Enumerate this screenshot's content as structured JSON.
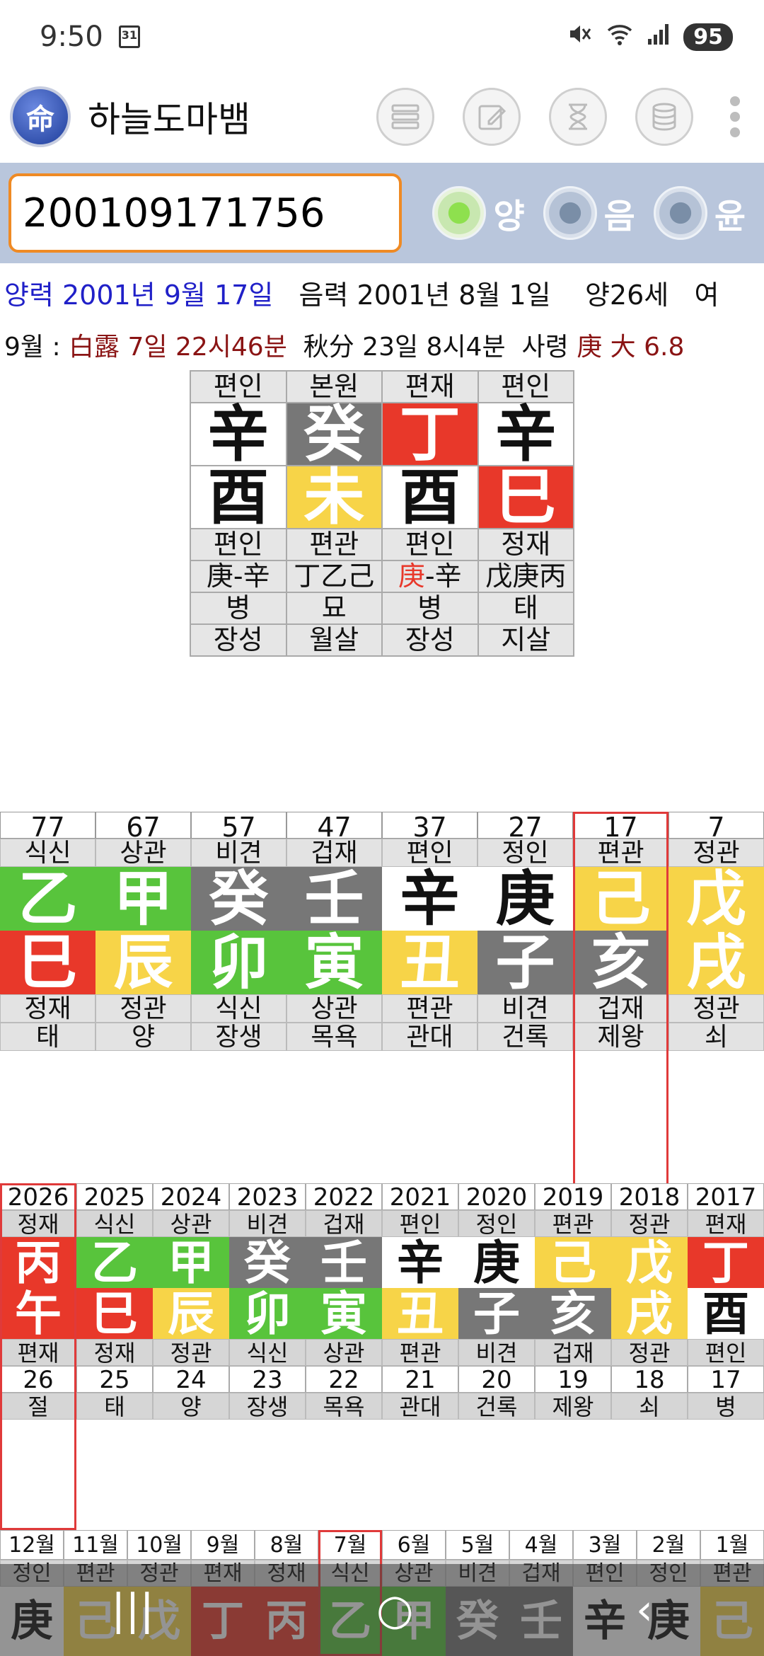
{
  "status": {
    "time": "9:50",
    "calendar_day": "31",
    "battery": "95"
  },
  "app": {
    "title": "하늘도마뱀",
    "logo_char": "命"
  },
  "input": {
    "value": "200109171756"
  },
  "radios": [
    {
      "label": "양",
      "selected": true
    },
    {
      "label": "음",
      "selected": false
    },
    {
      "label": "윤",
      "selected": false
    }
  ],
  "info": {
    "solar": "양력 2001년 9월 17일",
    "lunar": "음력 2001년 8월 1일",
    "age": "양26세",
    "gender": "여",
    "month_prefix": "9월 : ",
    "term1": "白露 7일 22시46분",
    "term2": "秋分 23일 8시4분",
    "saryeong_label": "사령",
    "saryeong_char": "庚",
    "saryeong_rest": "大 6.8"
  },
  "pillars": {
    "top_labels": [
      "편인",
      "본원",
      "편재",
      "편인"
    ],
    "stems": [
      {
        "char": "辛",
        "color": "white"
      },
      {
        "char": "癸",
        "color": "gray"
      },
      {
        "char": "丁",
        "color": "red"
      },
      {
        "char": "辛",
        "color": "white"
      }
    ],
    "branches": [
      {
        "char": "酉",
        "color": "white"
      },
      {
        "char": "未",
        "color": "yellow"
      },
      {
        "char": "酉",
        "color": "white"
      },
      {
        "char": "巳",
        "color": "red"
      }
    ],
    "bottom_labels": [
      "편인",
      "편관",
      "편인",
      "정재"
    ],
    "hidden": [
      {
        "a": "庚",
        "b": "-",
        "c": "辛",
        "hl": false
      },
      {
        "a": "丁",
        "b": "乙",
        "c": "己",
        "hl": false
      },
      {
        "a": "庚",
        "b": "-",
        "c": "辛",
        "hl": true
      },
      {
        "a": "戊",
        "b": "庚",
        "c": "丙",
        "hl": false
      }
    ],
    "stage": [
      "병",
      "묘",
      "병",
      "태"
    ],
    "sal": [
      "장성",
      "월살",
      "장성",
      "지살"
    ]
  },
  "daeun": {
    "ages": [
      "77",
      "67",
      "57",
      "47",
      "37",
      "27",
      "17",
      "7"
    ],
    "top_labels": [
      "식신",
      "상관",
      "비견",
      "겁재",
      "편인",
      "정인",
      "편관",
      "정관"
    ],
    "stems": [
      {
        "char": "乙",
        "color": "green"
      },
      {
        "char": "甲",
        "color": "green"
      },
      {
        "char": "癸",
        "color": "gray"
      },
      {
        "char": "壬",
        "color": "gray"
      },
      {
        "char": "辛",
        "color": "white"
      },
      {
        "char": "庚",
        "color": "white"
      },
      {
        "char": "己",
        "color": "yellow"
      },
      {
        "char": "戊",
        "color": "yellow"
      }
    ],
    "branches": [
      {
        "char": "巳",
        "color": "red"
      },
      {
        "char": "辰",
        "color": "yellow"
      },
      {
        "char": "卯",
        "color": "green"
      },
      {
        "char": "寅",
        "color": "green"
      },
      {
        "char": "丑",
        "color": "yellow"
      },
      {
        "char": "子",
        "color": "gray"
      },
      {
        "char": "亥",
        "color": "gray"
      },
      {
        "char": "戌",
        "color": "yellow"
      }
    ],
    "bottom_labels": [
      "정재",
      "정관",
      "식신",
      "상관",
      "편관",
      "비견",
      "겁재",
      "정관"
    ],
    "stage": [
      "태",
      "양",
      "장생",
      "목욕",
      "관대",
      "건록",
      "제왕",
      "쇠"
    ],
    "selected_index": 6
  },
  "yearly": {
    "years": [
      "2026",
      "2025",
      "2024",
      "2023",
      "2022",
      "2021",
      "2020",
      "2019",
      "2018",
      "2017"
    ],
    "top_labels": [
      "정재",
      "식신",
      "상관",
      "비견",
      "겁재",
      "편인",
      "정인",
      "편관",
      "정관",
      "편재"
    ],
    "stems": [
      {
        "char": "丙",
        "color": "red"
      },
      {
        "char": "乙",
        "color": "green"
      },
      {
        "char": "甲",
        "color": "green"
      },
      {
        "char": "癸",
        "color": "gray"
      },
      {
        "char": "壬",
        "color": "gray"
      },
      {
        "char": "辛",
        "color": "white"
      },
      {
        "char": "庚",
        "color": "white"
      },
      {
        "char": "己",
        "color": "yellow"
      },
      {
        "char": "戊",
        "color": "yellow"
      },
      {
        "char": "丁",
        "color": "red"
      }
    ],
    "branches": [
      {
        "char": "午",
        "color": "red"
      },
      {
        "char": "巳",
        "color": "red"
      },
      {
        "char": "辰",
        "color": "yellow"
      },
      {
        "char": "卯",
        "color": "green"
      },
      {
        "char": "寅",
        "color": "green"
      },
      {
        "char": "丑",
        "color": "yellow"
      },
      {
        "char": "子",
        "color": "gray"
      },
      {
        "char": "亥",
        "color": "gray"
      },
      {
        "char": "戌",
        "color": "yellow"
      },
      {
        "char": "酉",
        "color": "white"
      }
    ],
    "bottom_labels": [
      "편재",
      "정재",
      "정관",
      "식신",
      "상관",
      "편관",
      "비견",
      "겁재",
      "정관",
      "편인"
    ],
    "ages": [
      "26",
      "25",
      "24",
      "23",
      "22",
      "21",
      "20",
      "19",
      "18",
      "17"
    ],
    "stage": [
      "절",
      "태",
      "양",
      "장생",
      "목욕",
      "관대",
      "건록",
      "제왕",
      "쇠",
      "병"
    ],
    "selected_index": 0
  },
  "monthly": {
    "months": [
      "12월",
      "11월",
      "10월",
      "9월",
      "8월",
      "7월",
      "6월",
      "5월",
      "4월",
      "3월",
      "2월",
      "1월"
    ],
    "top_labels": [
      "정인",
      "편관",
      "정관",
      "편재",
      "정재",
      "식신",
      "상관",
      "비견",
      "겁재",
      "편인",
      "정인",
      "편관"
    ],
    "stems": [
      {
        "char": "庚",
        "color": "white"
      },
      {
        "char": "己",
        "color": "yellow"
      },
      {
        "char": "戊",
        "color": "yellow"
      },
      {
        "char": "丁",
        "color": "red"
      },
      {
        "char": "丙",
        "color": "red"
      },
      {
        "char": "乙",
        "color": "green"
      },
      {
        "char": "甲",
        "color": "green"
      },
      {
        "char": "癸",
        "color": "gray"
      },
      {
        "char": "壬",
        "color": "gray"
      },
      {
        "char": "辛",
        "color": "white"
      },
      {
        "char": "庚",
        "color": "white"
      },
      {
        "char": "己",
        "color": "yellow"
      }
    ],
    "selected_index": 5
  },
  "nav": {
    "back": "‹",
    "home": "○",
    "recents": "|||"
  },
  "colors": {
    "white": "#ffffff",
    "gray": "#777777",
    "red": "#e8382a",
    "yellow": "#f7d448",
    "green": "#58c43c",
    "accent": "#ef8a24",
    "bar": "#b9c6dc"
  }
}
